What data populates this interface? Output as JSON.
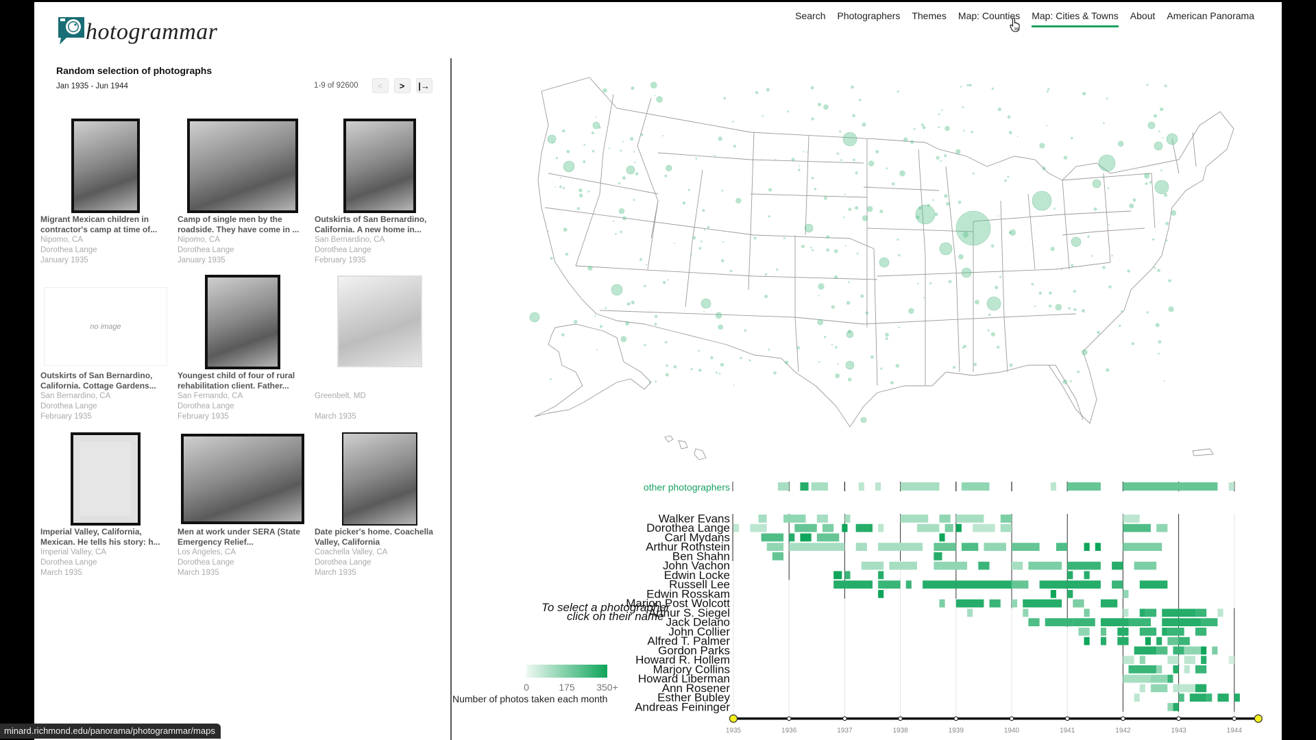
{
  "app": {
    "logo_text": "hotogrammar",
    "brand_color": "#186e74",
    "accent_color": "#1aa260"
  },
  "nav": {
    "items": [
      {
        "label": "Search",
        "active": false
      },
      {
        "label": "Photographers",
        "active": false
      },
      {
        "label": "Themes",
        "active": false
      },
      {
        "label": "Map: Counties",
        "active": false
      },
      {
        "label": "Map: Cities & Towns",
        "active": true
      },
      {
        "label": "About",
        "active": false
      },
      {
        "label": "American Panorama",
        "active": false
      }
    ]
  },
  "left_panel": {
    "title": "Random selection of photographs",
    "date_range": "Jan 1935 - Jun 1944",
    "pager": {
      "count": "1-9 of 92600",
      "prev_icon": "<",
      "next_icon": ">",
      "last_icon": "|→"
    },
    "photos": [
      {
        "title": "Migrant Mexican children in contractor's camp at time of...",
        "place": "Nipomo, CA",
        "photographer": "Dorothea Lange",
        "date": "January 1935",
        "has_image": true
      },
      {
        "title": "Camp of single men by the roadside. They have come in ...",
        "place": "Nipomo, CA",
        "photographer": "Dorothea Lange",
        "date": "January 1935",
        "has_image": true
      },
      {
        "title": "Outskirts of San Bernardino, California. A new home in...",
        "place": "San Bernardino, CA",
        "photographer": "Dorothea Lange",
        "date": "February 1935",
        "has_image": true
      },
      {
        "title": "Outskirts of San Bernardino, California. Cottage Gardens...",
        "place": "San Bernardino, CA",
        "photographer": "Dorothea Lange",
        "date": "February 1935",
        "has_image": false,
        "no_image_label": "no image"
      },
      {
        "title": "Youngest child of four of rural rehabilitation client. Father...",
        "place": "San Fernando, CA",
        "photographer": "Dorothea Lange",
        "date": "February 1935",
        "has_image": true
      },
      {
        "title": "",
        "place": "Greenbelt, MD",
        "photographer": "",
        "date": "March 1935",
        "has_image": true
      },
      {
        "title": "Imperial Valley, California, Mexican. He tells his story: h...",
        "place": "Imperial Valley, CA",
        "photographer": "Dorothea Lange",
        "date": "March 1935",
        "has_image": true
      },
      {
        "title": "Men at work under SERA (State Emergency Relief...",
        "place": "Los Angeles, CA",
        "photographer": "Dorothea Lange",
        "date": "March 1935",
        "has_image": true
      },
      {
        "title": "Date picker's home. Coachella Valley, California",
        "place": "Coachella Valley, CA",
        "photographer": "Dorothea Lange",
        "date": "March 1935",
        "has_image": true
      }
    ]
  },
  "map": {
    "marker_color": "#5fc38f",
    "description": "US map of cities & towns with photo-count circles"
  },
  "timeline": {
    "other_label": "other photographers",
    "hint_line1": "To select a photographer",
    "hint_line2": "click on their name",
    "legend": {
      "min_label": "0",
      "mid_label": "175",
      "max_label": "350+",
      "caption": "Number of photos taken each month"
    },
    "selection_start_year": 1935,
    "selection_end": "Jun 1944"
  },
  "chart_data": {
    "type": "heatmap",
    "title": "",
    "xlabel": "",
    "ylabel": "",
    "x": [
      "1935",
      "1936",
      "1937",
      "1938",
      "1939",
      "1940",
      "1941",
      "1942",
      "1943",
      "1944"
    ],
    "value_range": [
      0,
      350
    ],
    "color_low": "#e8f6ee",
    "color_high": "#0fa55a",
    "rows": [
      {
        "name": "other photographers",
        "spans": [
          [
            1935.8,
            1936.0,
            0.3
          ],
          [
            1936.2,
            1936.35,
            0.9
          ],
          [
            1936.4,
            1936.7,
            0.3
          ],
          [
            1937.25,
            1937.35,
            0.2
          ],
          [
            1937.55,
            1937.65,
            0.2
          ],
          [
            1938.0,
            1938.7,
            0.3
          ],
          [
            1939.1,
            1939.6,
            0.4
          ],
          [
            1940.7,
            1940.8,
            0.2
          ],
          [
            1941.0,
            1941.6,
            0.6
          ],
          [
            1942.0,
            1943.7,
            0.6
          ],
          [
            1943.9,
            1944.0,
            0.2
          ]
        ]
      },
      {
        "name": "Walker Evans",
        "spans": [
          [
            1935.45,
            1935.6,
            0.3
          ],
          [
            1935.9,
            1936.3,
            0.4
          ],
          [
            1936.5,
            1936.7,
            0.3
          ],
          [
            1937.0,
            1937.1,
            0.3
          ],
          [
            1938.0,
            1938.5,
            0.3
          ],
          [
            1938.7,
            1938.9,
            0.4
          ],
          [
            1939.0,
            1939.5,
            0.3
          ],
          [
            1939.8,
            1940.0,
            0.5
          ],
          [
            1942.0,
            1942.3,
            0.2
          ]
        ]
      },
      {
        "name": "Dorothea Lange",
        "spans": [
          [
            1935.0,
            1935.1,
            0.2
          ],
          [
            1935.3,
            1935.6,
            0.2
          ],
          [
            1936.1,
            1936.5,
            0.6
          ],
          [
            1936.6,
            1936.8,
            0.5
          ],
          [
            1936.95,
            1937.05,
            1.0
          ],
          [
            1937.2,
            1937.5,
            0.9
          ],
          [
            1937.6,
            1937.7,
            0.2
          ],
          [
            1938.3,
            1938.7,
            0.3
          ],
          [
            1938.8,
            1938.95,
            0.5
          ],
          [
            1939.0,
            1939.1,
            1.0
          ],
          [
            1939.3,
            1939.7,
            0.2
          ],
          [
            1939.8,
            1940.0,
            0.3
          ],
          [
            1942.0,
            1942.5,
            0.7
          ],
          [
            1942.6,
            1942.8,
            0.4
          ]
        ]
      },
      {
        "name": "Carl Mydans",
        "spans": [
          [
            1935.5,
            1935.9,
            0.7
          ],
          [
            1936.0,
            1936.1,
            0.9
          ],
          [
            1936.2,
            1936.4,
            1.0
          ],
          [
            1936.5,
            1936.9,
            0.6
          ],
          [
            1938.7,
            1938.8,
            1.0
          ]
        ]
      },
      {
        "name": "Arthur Rothstein",
        "spans": [
          [
            1935.6,
            1935.9,
            0.4
          ],
          [
            1936.0,
            1937.0,
            0.3
          ],
          [
            1937.2,
            1937.4,
            0.3
          ],
          [
            1937.6,
            1938.4,
            0.3
          ],
          [
            1938.6,
            1939.0,
            0.6
          ],
          [
            1939.1,
            1939.4,
            0.7
          ],
          [
            1939.5,
            1939.9,
            0.4
          ],
          [
            1940.0,
            1940.5,
            0.6
          ],
          [
            1940.8,
            1941.0,
            0.7
          ],
          [
            1941.3,
            1941.4,
            1.0
          ],
          [
            1941.5,
            1941.6,
            1.0
          ],
          [
            1942.0,
            1942.7,
            0.5
          ]
        ]
      },
      {
        "name": "Ben Shahn",
        "spans": [
          [
            1935.7,
            1935.9,
            0.6
          ],
          [
            1938.6,
            1938.75,
            0.9
          ]
        ]
      },
      {
        "name": "John Vachon",
        "spans": [
          [
            1937.3,
            1937.7,
            0.3
          ],
          [
            1937.8,
            1938.3,
            0.3
          ],
          [
            1938.6,
            1939.2,
            0.4
          ],
          [
            1939.4,
            1939.6,
            0.8
          ],
          [
            1940.0,
            1940.2,
            0.3
          ],
          [
            1940.3,
            1940.9,
            0.5
          ],
          [
            1941.0,
            1941.6,
            0.8
          ],
          [
            1941.8,
            1942.0,
            0.9
          ],
          [
            1942.2,
            1942.6,
            0.5
          ]
        ]
      },
      {
        "name": "Edwin Locke",
        "spans": [
          [
            1936.8,
            1936.95,
            1.0
          ],
          [
            1937.0,
            1937.1,
            0.8
          ],
          [
            1937.6,
            1937.7,
            0.9
          ],
          [
            1941.0,
            1941.1,
            0.9
          ],
          [
            1941.3,
            1941.4,
            0.9
          ]
        ]
      },
      {
        "name": "Russell Lee",
        "spans": [
          [
            1936.8,
            1937.5,
            0.9
          ],
          [
            1937.6,
            1938.0,
            0.8
          ],
          [
            1938.1,
            1938.2,
            0.8
          ],
          [
            1938.4,
            1939.0,
            0.9
          ],
          [
            1939.0,
            1940.0,
            0.9
          ],
          [
            1940.0,
            1940.3,
            0.6
          ],
          [
            1940.5,
            1941.0,
            0.9
          ],
          [
            1941.0,
            1941.6,
            0.9
          ],
          [
            1941.8,
            1942.0,
            0.8
          ],
          [
            1942.3,
            1942.8,
            0.9
          ]
        ]
      },
      {
        "name": "Edwin Rosskam",
        "spans": [
          [
            1937.6,
            1937.7,
            1.0
          ],
          [
            1940.7,
            1940.8,
            1.0
          ],
          [
            1941.0,
            1941.1,
            0.9
          ],
          [
            1942.0,
            1942.1,
            0.4
          ]
        ]
      },
      {
        "name": "Marion Post Wolcott",
        "spans": [
          [
            1938.7,
            1938.8,
            0.5
          ],
          [
            1939.0,
            1939.5,
            0.9
          ],
          [
            1939.6,
            1939.8,
            0.8
          ],
          [
            1940.0,
            1940.1,
            0.4
          ],
          [
            1940.2,
            1940.9,
            0.9
          ],
          [
            1941.1,
            1941.3,
            0.5
          ],
          [
            1941.6,
            1941.9,
            0.9
          ]
        ]
      },
      {
        "name": "Arthur S. Siegel",
        "spans": [
          [
            1939.2,
            1939.3,
            0.3
          ],
          [
            1940.2,
            1940.3,
            0.4
          ],
          [
            1941.3,
            1941.4,
            0.5
          ],
          [
            1942.0,
            1942.1,
            0.2
          ],
          [
            1942.3,
            1942.4,
            0.9
          ],
          [
            1942.4,
            1942.6,
            0.8
          ],
          [
            1942.7,
            1943.0,
            0.9
          ],
          [
            1943.0,
            1943.3,
            0.9
          ],
          [
            1943.3,
            1943.5,
            0.8
          ],
          [
            1943.7,
            1943.8,
            0.2
          ]
        ]
      },
      {
        "name": "Jack Delano",
        "spans": [
          [
            1940.3,
            1940.5,
            0.7
          ],
          [
            1940.6,
            1941.1,
            0.8
          ],
          [
            1941.1,
            1941.5,
            0.8
          ],
          [
            1941.6,
            1941.7,
            0.9
          ],
          [
            1941.7,
            1942.1,
            0.9
          ],
          [
            1942.1,
            1942.5,
            0.8
          ],
          [
            1942.7,
            1943.0,
            0.9
          ],
          [
            1943.0,
            1943.4,
            0.9
          ],
          [
            1943.4,
            1943.7,
            0.8
          ]
        ]
      },
      {
        "name": "John Collier",
        "spans": [
          [
            1941.2,
            1941.4,
            0.4
          ],
          [
            1941.6,
            1941.7,
            0.6
          ],
          [
            1941.9,
            1942.1,
            0.9
          ],
          [
            1942.3,
            1942.6,
            0.8
          ],
          [
            1942.7,
            1942.8,
            0.9
          ],
          [
            1942.8,
            1943.1,
            0.8
          ],
          [
            1943.3,
            1943.5,
            0.8
          ]
        ]
      },
      {
        "name": "Alfred T. Palmer",
        "spans": [
          [
            1941.3,
            1941.4,
            1.0
          ],
          [
            1941.6,
            1941.7,
            0.9
          ],
          [
            1941.9,
            1942.1,
            0.9
          ],
          [
            1942.4,
            1942.5,
            1.0
          ],
          [
            1942.6,
            1942.7,
            0.9
          ],
          [
            1942.8,
            1943.0,
            0.6
          ],
          [
            1943.0,
            1943.2,
            0.8
          ]
        ]
      },
      {
        "name": "Gordon Parks",
        "spans": [
          [
            1942.2,
            1942.6,
            0.9
          ],
          [
            1942.6,
            1942.8,
            0.7
          ],
          [
            1942.9,
            1943.1,
            0.8
          ],
          [
            1943.1,
            1943.4,
            0.4
          ],
          [
            1943.4,
            1943.5,
            1.0
          ],
          [
            1943.6,
            1943.7,
            0.5
          ]
        ]
      },
      {
        "name": "Howard R. Hollem",
        "spans": [
          [
            1942.0,
            1942.2,
            0.2
          ],
          [
            1942.3,
            1942.4,
            0.4
          ],
          [
            1942.8,
            1943.0,
            0.2
          ],
          [
            1943.1,
            1943.3,
            0.2
          ],
          [
            1943.4,
            1943.5,
            0.9
          ],
          [
            1943.9,
            1944.0,
            0.1
          ]
        ]
      },
      {
        "name": "Marjory Collins",
        "spans": [
          [
            1942.1,
            1942.6,
            0.8
          ],
          [
            1942.6,
            1942.7,
            0.4
          ],
          [
            1942.9,
            1943.0,
            0.9
          ],
          [
            1943.1,
            1943.2,
            0.2
          ],
          [
            1943.3,
            1943.5,
            0.8
          ]
        ]
      },
      {
        "name": "Howard Liberman",
        "spans": [
          [
            1942.0,
            1942.5,
            0.3
          ],
          [
            1942.5,
            1942.8,
            0.4
          ],
          [
            1942.8,
            1942.9,
            0.8
          ]
        ]
      },
      {
        "name": "Ann Rosener",
        "spans": [
          [
            1942.3,
            1942.4,
            0.2
          ],
          [
            1942.5,
            1942.8,
            0.4
          ],
          [
            1942.9,
            1943.0,
            0.2
          ],
          [
            1943.0,
            1943.3,
            0.2
          ],
          [
            1943.3,
            1943.5,
            0.9
          ]
        ]
      },
      {
        "name": "Esther Bubley",
        "spans": [
          [
            1942.2,
            1942.3,
            0.2
          ],
          [
            1943.0,
            1943.1,
            0.7
          ],
          [
            1943.2,
            1943.5,
            0.9
          ],
          [
            1943.5,
            1943.6,
            0.8
          ],
          [
            1943.7,
            1943.9,
            0.9
          ],
          [
            1944.0,
            1944.1,
            0.9
          ]
        ]
      },
      {
        "name": "Andreas Feininger",
        "spans": [
          [
            1942.8,
            1942.9,
            0.4
          ],
          [
            1942.9,
            1943.0,
            0.9
          ]
        ]
      }
    ]
  },
  "status_bar": {
    "url": "minard.richmond.edu/panorama/photogrammar/maps"
  }
}
